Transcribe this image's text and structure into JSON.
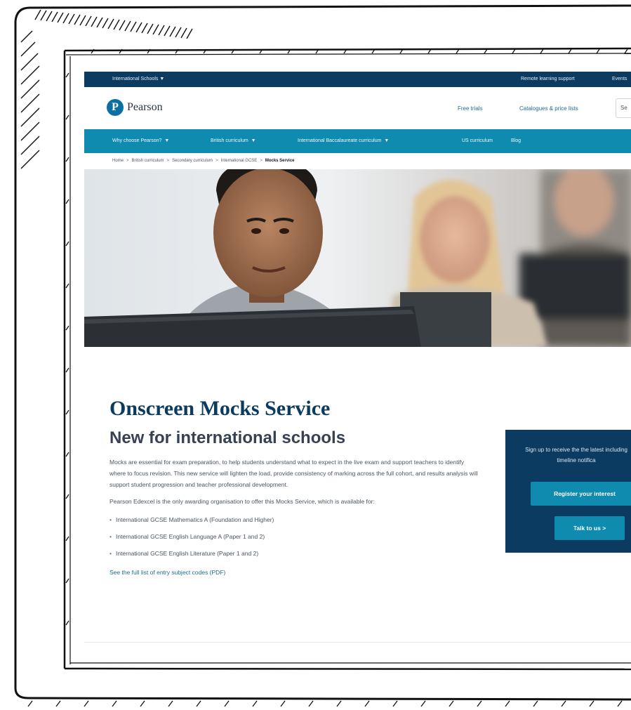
{
  "utility_bar": {
    "region": "International Schools",
    "remote_learning": "Remote learning support",
    "events": "Events"
  },
  "header": {
    "logo_mark": "P",
    "logo_text": "Pearson",
    "free_trials": "Free trials",
    "catalogues": "Catalogues & price lists",
    "search_value": "Se"
  },
  "main_nav": [
    {
      "label": "Why choose Pearson?",
      "dropdown": true
    },
    {
      "label": "British curriculum",
      "dropdown": true
    },
    {
      "label": "International Baccalaureate curriculum",
      "dropdown": true
    },
    {
      "label": "US curriculum",
      "dropdown": false
    },
    {
      "label": "Blog",
      "dropdown": false
    }
  ],
  "breadcrumb": {
    "items": [
      "Home",
      "British curriculum",
      "Secondary curriculum",
      "International GCSE"
    ],
    "current": "Mocks Service"
  },
  "page": {
    "title": "Onscreen Mocks Service",
    "subtitle": "New for international schools",
    "paragraph1": "Mocks are essential for exam preparation, to help students understand what to expect in the live exam and support teachers to identify where to focus revision. This new service will lighten the load, provide consistency of marking across the full cohort, and results analysis will support student progression and teacher professional development.",
    "paragraph2": "Pearson Edexcel is the only awarding organisation to offer this Mocks Service, which is available for:",
    "bullets": [
      "International GCSE Mathematics A (Foundation and Higher)",
      "International GCSE English Language A (Paper 1 and 2)",
      "International GCSE English Literature (Paper 1 and 2)"
    ],
    "pdf_link": "See the full list of entry subject codes (PDF)"
  },
  "signup_panel": {
    "text": "Sign up to receive the the latest including timeline notifica",
    "register_button": "Register your interest",
    "talk_button": "Talk to us >"
  },
  "colors": {
    "navy": "#0b3b60",
    "teal": "#0f8bb0",
    "link": "#1f6c8e"
  }
}
